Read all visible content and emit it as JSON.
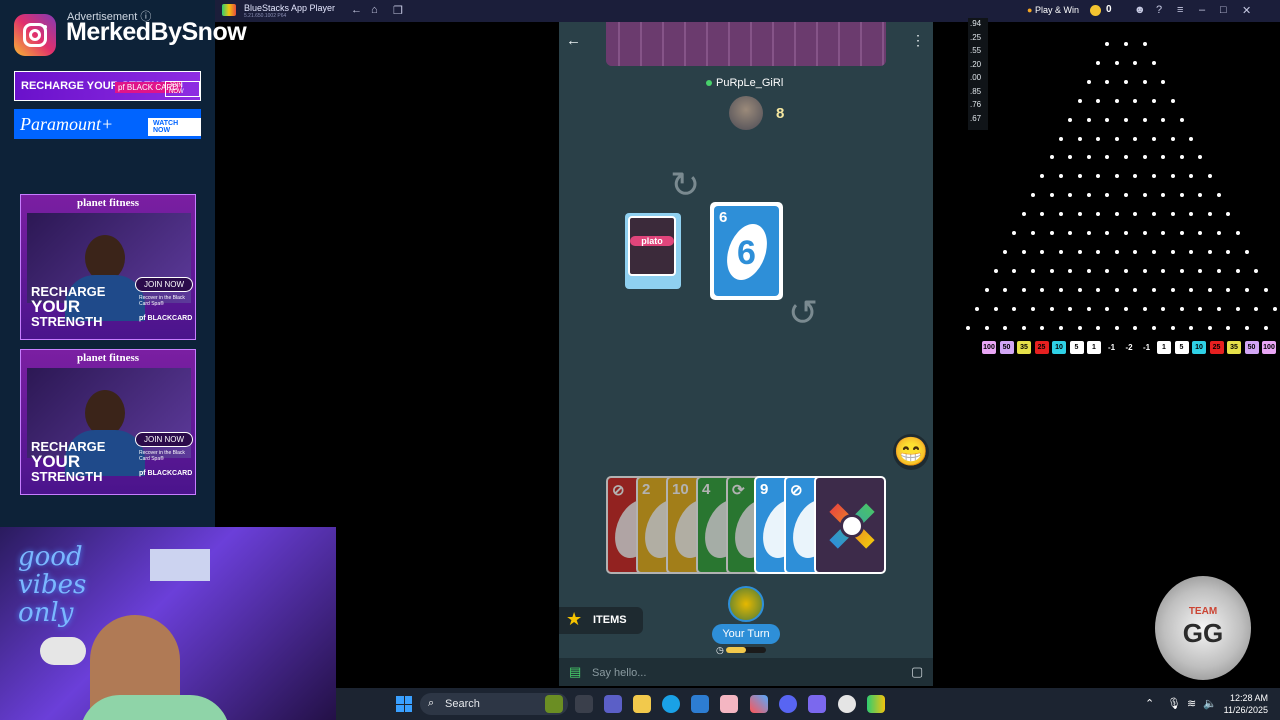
{
  "streamer": {
    "ad_header": "Advertisement ⓘ",
    "handle": "MerkedBySnow"
  },
  "ads": {
    "banner1_text": "RECHARGE YOUR STRENGTH",
    "banner1_brand": "pf BLACK CARD",
    "banner1_cta": "JOIN NOW",
    "banner2_text": "Paramount+",
    "banner2_cta": "WATCH NOW",
    "pf_ad": {
      "brand": "planet fitness",
      "line1": "RECHARGE",
      "line2": "YOUR",
      "line3": "STRENGTH",
      "cta": "JOIN NOW",
      "sub": "Recover in the Black Card Spa®",
      "card": "pf BLACKCARD",
      "fine": "See club for details."
    }
  },
  "webcam": {
    "neon_text": "good vibes only"
  },
  "bluestacks": {
    "title": "BlueStacks App Player",
    "subtitle": "5.21.650.1002 P64",
    "play_win": "Play & Win",
    "coins": "0",
    "colors": {
      "bar": "#1b1e3a"
    }
  },
  "game": {
    "opponent_name": "PuRpLe_GiRl",
    "opponent_card_count": "8",
    "deck_label": "plato",
    "discard": {
      "value": "6",
      "color": "#2e8fd8"
    },
    "hand": [
      {
        "label": "⊘",
        "color": "#d0312d"
      },
      {
        "label": "2",
        "color": "#e8b424"
      },
      {
        "label": "10",
        "color": "#e8b424"
      },
      {
        "label": "4",
        "color": "#3aa845"
      },
      {
        "label": "⟳",
        "color": "#3aa845"
      },
      {
        "label": "9",
        "color": "#2e8fd8"
      },
      {
        "label": "⊘",
        "color": "#2e8fd8"
      }
    ],
    "items_label": "ITEMS",
    "turn_label": "Your Turn",
    "timer_fraction": 0.5,
    "chat_placeholder": "Say hello..."
  },
  "plinko": {
    "odds": [
      ".94",
      ".25",
      ".55",
      ".20",
      ".00",
      ".85",
      ".76",
      ".67"
    ],
    "slots": [
      {
        "v": "100",
        "c": "#e9a6f5"
      },
      {
        "v": "50",
        "c": "#d2a6f5"
      },
      {
        "v": "35",
        "c": "#e5e14a"
      },
      {
        "v": "25",
        "c": "#e62020"
      },
      {
        "v": "10",
        "c": "#2fd1e6"
      },
      {
        "v": "5",
        "c": "#ffffff"
      },
      {
        "v": "1",
        "c": "#ffffff"
      },
      {
        "v": "-1",
        "c": ""
      },
      {
        "v": "-2",
        "c": ""
      },
      {
        "v": "-1",
        "c": ""
      },
      {
        "v": "1",
        "c": "#ffffff"
      },
      {
        "v": "5",
        "c": "#ffffff"
      },
      {
        "v": "10",
        "c": "#2fd1e6"
      },
      {
        "v": "25",
        "c": "#e62020"
      },
      {
        "v": "35",
        "c": "#e5e14a"
      },
      {
        "v": "50",
        "c": "#d2a6f5"
      },
      {
        "v": "100",
        "c": "#e9a6f5"
      }
    ],
    "logo_top": "TEAM",
    "logo_main": "GG"
  },
  "taskbar": {
    "search_label": "Search",
    "time": "12:28 AM",
    "date": "11/26/2025"
  }
}
